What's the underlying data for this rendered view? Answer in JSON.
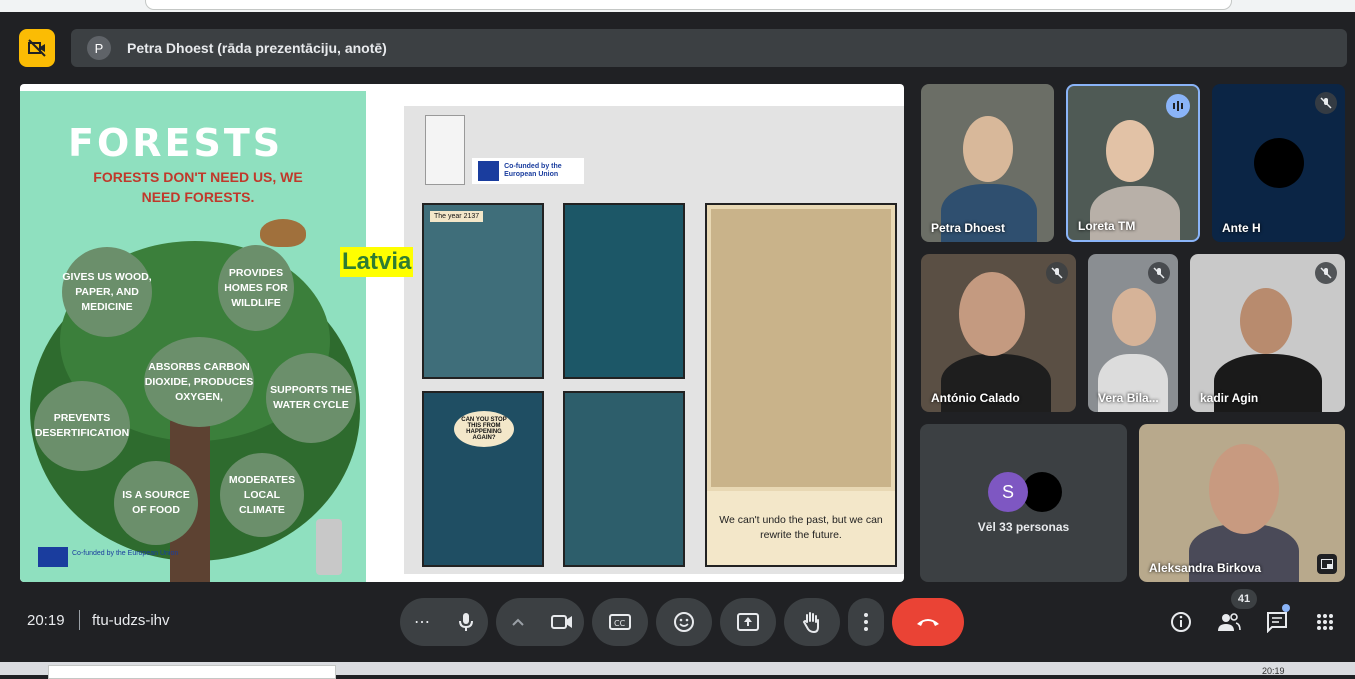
{
  "presentation": {
    "avatar_letter": "P",
    "presenter_text": "Petra Dhoest (rāda prezentāciju, anotē)"
  },
  "slide": {
    "poster_title": "FORESTS",
    "poster_subtitle": "FORESTS DON'T NEED US, WE NEED FORESTS.",
    "bubbles": [
      "GIVES US WOOD, PAPER, AND MEDICINE",
      "PROVIDES HOMES FOR WILDLIFE",
      "ABSORBS CARBON DIOXIDE, PRODUCES OXYGEN,",
      "SUPPORTS THE WATER CYCLE",
      "PREVENTS DESERTIFICATION",
      "IS A SOURCE OF FOOD",
      "MODERATES LOCAL CLIMATE"
    ],
    "poster_eu_text": "Co-funded by the European Union",
    "annotation": "Latvia",
    "comic_eu_text": "Co-funded by the European Union",
    "panel1_label": "The year 2137",
    "panel3_speech": "CAN YOU STOP THIS FROM HAPPENING AGAIN?",
    "caption": "We can't undo the past, but we can rewrite the future."
  },
  "participants": [
    {
      "name": "Petra Dhoest"
    },
    {
      "name": "Loreta TM"
    },
    {
      "name": "Ante H"
    },
    {
      "name": "António Calado"
    },
    {
      "name": "Vera Bila..."
    },
    {
      "name": "kadir Agin"
    },
    {
      "name": "Aleksandra Birkova"
    }
  ],
  "more_tile": {
    "avatar_letter": "S",
    "label": "Vēl 33 personas"
  },
  "bottom_bar": {
    "time": "20:19",
    "meeting_code": "ftu-udzs-ihv",
    "people_count": "41",
    "more_dots": "⋯"
  },
  "browser": {
    "clock": "20:19"
  },
  "colors": {
    "background": "#202124",
    "control": "#3c4043",
    "end_call": "#ea4335",
    "accent": "#8ab4f8",
    "cam_off": "#fbbc04"
  }
}
